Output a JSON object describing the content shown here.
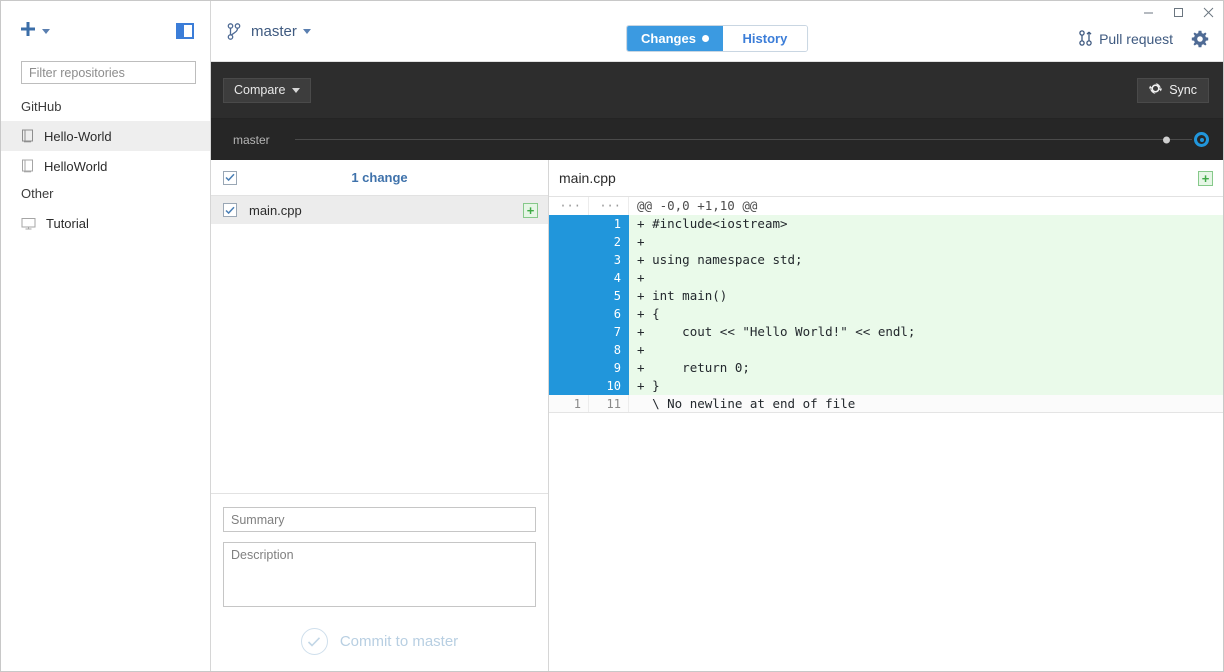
{
  "window": {
    "minimize_label": "–",
    "maximize_label": "□",
    "close_label": "✕"
  },
  "sidebar": {
    "add_icon": "plus-icon",
    "panel_toggle_icon": "sidebar-toggle-icon",
    "filter": {
      "placeholder": "Filter repositories",
      "value": ""
    },
    "groups": [
      {
        "label": "GitHub",
        "items": [
          {
            "label": "Hello-World",
            "icon": "repo-icon",
            "selected": true
          },
          {
            "label": "HelloWorld",
            "icon": "repo-icon",
            "selected": false
          }
        ]
      },
      {
        "label": "Other",
        "items": [
          {
            "label": "Tutorial",
            "icon": "monitor-icon",
            "selected": false
          }
        ]
      }
    ]
  },
  "header": {
    "branch_icon": "git-branch-icon",
    "branch_name": "master",
    "tabs": [
      {
        "label": "Changes",
        "active": true,
        "dot": true
      },
      {
        "label": "History",
        "active": false,
        "dot": false
      }
    ],
    "pull_request_label": "Pull request",
    "pull_request_icon": "pull-request-icon",
    "settings_icon": "gear-icon"
  },
  "toolbar": {
    "compare_label": "Compare",
    "sync_label": "Sync",
    "sync_icon": "sync-icon",
    "timeline_branch_label": "master"
  },
  "changes": {
    "count_label": "1 change",
    "select_all_checked": true,
    "files": [
      {
        "name": "main.cpp",
        "checked": true,
        "status": "+",
        "selected": true
      }
    ]
  },
  "commit": {
    "summary_placeholder": "Summary",
    "summary_value": "",
    "description_placeholder": "Description",
    "description_value": "",
    "button_label": "Commit to master",
    "button_enabled": false
  },
  "diff": {
    "file_name": "main.cpp",
    "status_badge": "+",
    "lines": [
      {
        "old": "···",
        "new": "···",
        "marker": "",
        "text": "@@ -0,0 +1,10 @@",
        "type": "hunk"
      },
      {
        "old": "",
        "new": "1",
        "marker": "+",
        "text": "#include<iostream>",
        "type": "added"
      },
      {
        "old": "",
        "new": "2",
        "marker": "+",
        "text": "",
        "type": "added"
      },
      {
        "old": "",
        "new": "3",
        "marker": "+",
        "text": "using namespace std;",
        "type": "added"
      },
      {
        "old": "",
        "new": "4",
        "marker": "+",
        "text": "",
        "type": "added"
      },
      {
        "old": "",
        "new": "5",
        "marker": "+",
        "text": "int main()",
        "type": "added"
      },
      {
        "old": "",
        "new": "6",
        "marker": "+",
        "text": "{",
        "type": "added"
      },
      {
        "old": "",
        "new": "7",
        "marker": "+",
        "text": "    cout << \"Hello World!\" << endl;",
        "type": "added"
      },
      {
        "old": "",
        "new": "8",
        "marker": "+",
        "text": "",
        "type": "added"
      },
      {
        "old": "",
        "new": "9",
        "marker": "+",
        "text": "    return 0;",
        "type": "added"
      },
      {
        "old": "",
        "new": "10",
        "marker": "+",
        "text": "}",
        "type": "added"
      },
      {
        "old": "1",
        "new": "11",
        "marker": "",
        "text": "\\ No newline at end of file",
        "type": "meta"
      }
    ]
  },
  "colors": {
    "accent_blue": "#3b9ae1",
    "gutter_blue": "#2196db",
    "added_green_bg": "#eafaea",
    "dark_toolbar": "#2d2d2d",
    "dark_timeline": "#262626",
    "link_blue": "#3f5a80"
  }
}
